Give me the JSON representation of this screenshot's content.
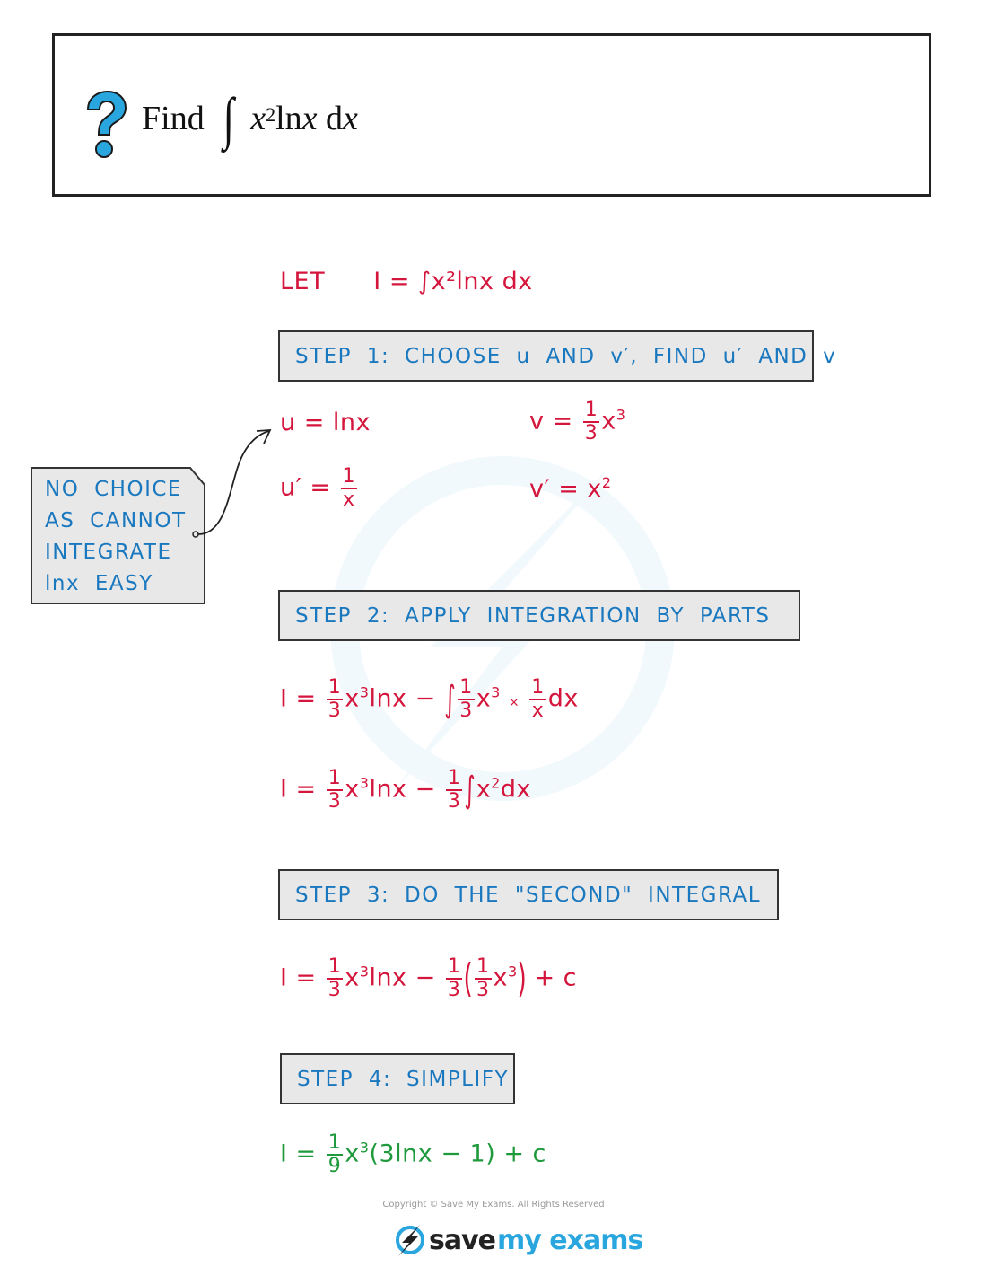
{
  "question": {
    "icon": "question-mark-icon",
    "prefix": "Find",
    "integrand_x": "x",
    "integrand_exp": "2",
    "integrand_rest": "ln",
    "integrand_x2": "x",
    "differential": " d",
    "differential_var": "x"
  },
  "let_line": {
    "label": "LET",
    "expr": "I = ∫x²lnx dx"
  },
  "steps": [
    {
      "label": "STEP 1: CHOOSE u AND v′, FIND u′ AND v"
    },
    {
      "label": "STEP 2: APPLY INTEGRATION BY PARTS"
    },
    {
      "label": "STEP 3: DO THE \"SECOND\" INTEGRAL"
    },
    {
      "label": "STEP 4: SIMPLIFY"
    }
  ],
  "step1": {
    "u": "u = lnx",
    "v_lhs": "v =",
    "v_num": "1",
    "v_den": "3",
    "v_tail": "x",
    "v_exp": "3",
    "du_lhs": "u′ =",
    "du_num": "1",
    "du_den": "x",
    "dv_lhs": "v′ = x",
    "dv_exp": "2"
  },
  "note": {
    "lines": [
      "NO CHOICE",
      "AS CANNOT",
      "INTEGRATE",
      "lnx EASY"
    ]
  },
  "step2": {
    "line1": {
      "lhs": "I =",
      "n1": "1",
      "d1": "3",
      "t1": "x",
      "e1": "3",
      "t2": "lnx −",
      "int": "∫",
      "n2": "1",
      "d2": "3",
      "t3": "x",
      "e2": "3",
      "times": "×",
      "n3": "1",
      "d3": "x",
      "t4": "dx"
    },
    "line2": {
      "lhs": "I =",
      "n1": "1",
      "d1": "3",
      "t1": "x",
      "e1": "3",
      "t2": "lnx −",
      "n2": "1",
      "d2": "3",
      "int": "∫",
      "t3": "x",
      "e2": "2",
      "t4": "dx"
    }
  },
  "step3": {
    "line": {
      "lhs": "I =",
      "n1": "1",
      "d1": "3",
      "t1": "x",
      "e1": "3",
      "t2": "lnx −",
      "n2": "1",
      "d2": "3",
      "lp": "(",
      "n3": "1",
      "d3": "3",
      "t3": "x",
      "e2": "3",
      "rp": ")",
      "t4": "+ c"
    }
  },
  "step4": {
    "line": {
      "lhs": "I =",
      "n1": "1",
      "d1": "9",
      "t1": "x",
      "e1": "3",
      "t2": "(3lnx − 1) + c"
    }
  },
  "footer": {
    "copyright": "Copyright © Save My Exams. All Rights Reserved",
    "logo_part1": "save",
    "logo_part2": "my exams"
  },
  "colors": {
    "working": "#d4163c",
    "answer": "#1e9a3c",
    "step_text": "#1a78bf",
    "step_bg": "#e8e8e8",
    "brand": "#2aa6df"
  }
}
